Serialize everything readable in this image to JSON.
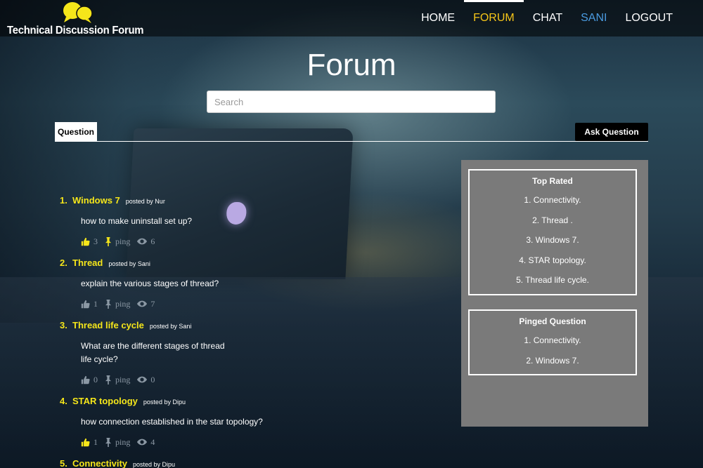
{
  "brand": {
    "title": "Technical Discussion Forum",
    "icon": "chat-bubbles-icon"
  },
  "nav": {
    "items": [
      {
        "label": "HOME",
        "state": "normal"
      },
      {
        "label": "FORUM",
        "state": "active"
      },
      {
        "label": "CHAT",
        "state": "normal"
      },
      {
        "label": "SANI",
        "state": "user"
      },
      {
        "label": "LOGOUT",
        "state": "normal"
      }
    ]
  },
  "page": {
    "title": "Forum"
  },
  "search": {
    "placeholder": "Search",
    "value": ""
  },
  "tabs": {
    "question": "Question",
    "ask_button": "Ask Question"
  },
  "questions": [
    {
      "num": "1.",
      "title": "Windows 7",
      "posted": "posted by Nur",
      "body": "how to make uninstall set up?",
      "likes": "3",
      "liked": true,
      "ping": "ping",
      "views": "6"
    },
    {
      "num": "2.",
      "title": "Thread",
      "posted": "posted by Sani",
      "body": "explain the various stages of thread?",
      "likes": "1",
      "liked": false,
      "ping": "ping",
      "views": "7"
    },
    {
      "num": "3.",
      "title": "Thread life cycle",
      "posted": "posted by Sani",
      "body": "What are the different stages of thread life cycle?",
      "likes": "0",
      "liked": false,
      "ping": "ping",
      "views": "0"
    },
    {
      "num": "4.",
      "title": "STAR topology",
      "posted": "posted by Dipu",
      "body": "how connection established in the star topology?",
      "likes": "1",
      "liked": true,
      "ping": "ping",
      "views": "4"
    },
    {
      "num": "5.",
      "title": "Connectivity",
      "posted": "posted by Dipu"
    }
  ],
  "sidebar": {
    "top_rated": {
      "title": "Top Rated",
      "items": [
        "1. Connectivity.",
        "2. Thread .",
        "3. Windows 7.",
        "4. STAR topology.",
        "5. Thread life cycle."
      ]
    },
    "pinged": {
      "title": "Pinged Question",
      "items": [
        "1. Connectivity.",
        "2. Windows 7."
      ]
    }
  },
  "colors": {
    "accent_yellow": "#f5e61a",
    "nav_active": "#f5c518",
    "nav_user": "#4a9be0",
    "sidebar_bg": "#7a7a7a"
  }
}
